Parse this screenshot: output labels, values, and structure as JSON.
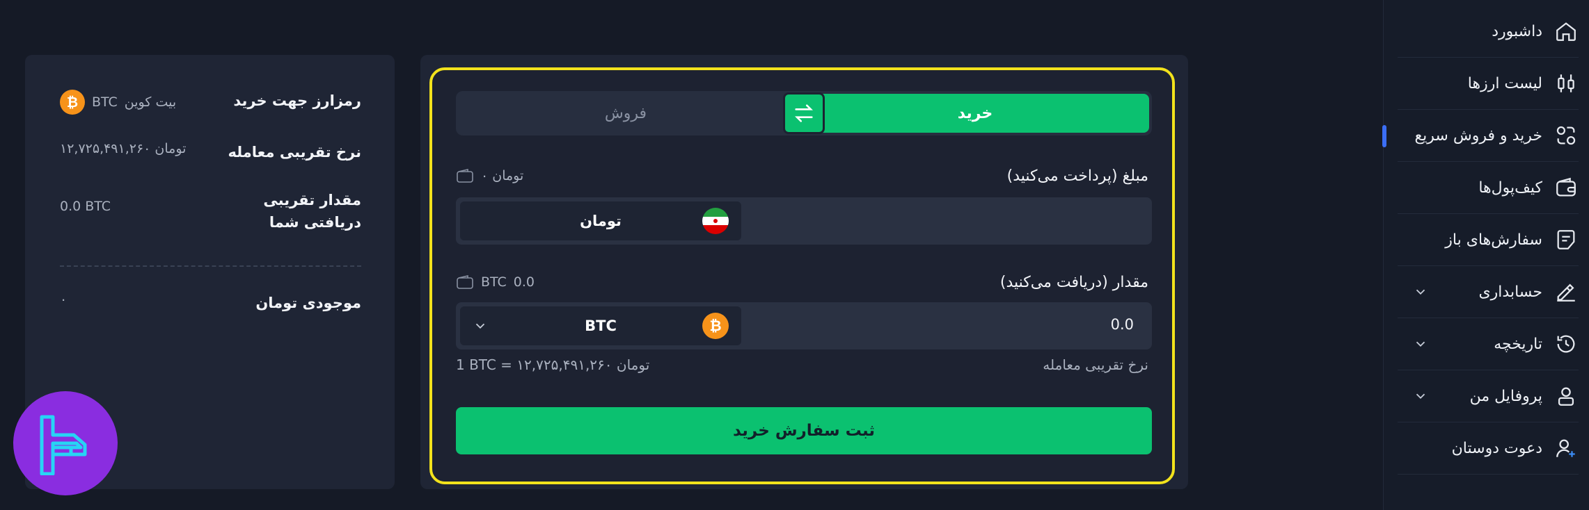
{
  "sidebar": {
    "items": [
      {
        "label": "داشبورد",
        "icon": "home-icon"
      },
      {
        "label": "لیست ارزها",
        "icon": "candlestick-icon"
      },
      {
        "label": "خرید و فروش سریع",
        "icon": "exchange-icon"
      },
      {
        "label": "کیف‌پول‌ها",
        "icon": "wallet-icon"
      },
      {
        "label": "سفارش‌های باز",
        "icon": "orders-icon"
      },
      {
        "label": "حسابداری",
        "icon": "accounting-icon"
      },
      {
        "label": "تاریخچه",
        "icon": "history-icon"
      },
      {
        "label": "پروفایل من",
        "icon": "profile-icon"
      },
      {
        "label": "دعوت دوستان",
        "icon": "invite-icon"
      }
    ],
    "active_index": 2,
    "accent": "#3b6ef5"
  },
  "info": {
    "crypto_label": "رمزارز جهت خرید",
    "crypto_name": "بیت کوین",
    "crypto_symbol": "BTC",
    "rate_label": "نرخ تقریبی معامله",
    "rate_value": "تومان ۱۲,۷۲۵,۴۹۱,۲۶۰",
    "receive_label": "مقدار تقریبی دریافتی شما",
    "receive_value": "0.0 BTC",
    "balance_label": "موجودی تومان",
    "balance_value": "۰"
  },
  "trade": {
    "buy_label": "خرید",
    "sell_label": "فروش",
    "pay_label": "مبلغ (پرداخت می‌کنید)",
    "pay_balance": "۰ تومان",
    "pay_currency": "تومان",
    "receive_label": "مقدار (دریافت می‌کنید)",
    "receive_balance_amount": "0.0",
    "receive_balance_symbol": "BTC",
    "receive_currency": "BTC",
    "receive_amount": "0.0",
    "rate_label": "نرخ تقریبی معامله",
    "rate_value": "1 BTC = ۱۲,۷۲۵,۴۹۱,۲۶۰ تومان",
    "submit_label": "ثبت سفارش خرید",
    "accent": "#0bc170",
    "highlight": "#f2e21c"
  }
}
